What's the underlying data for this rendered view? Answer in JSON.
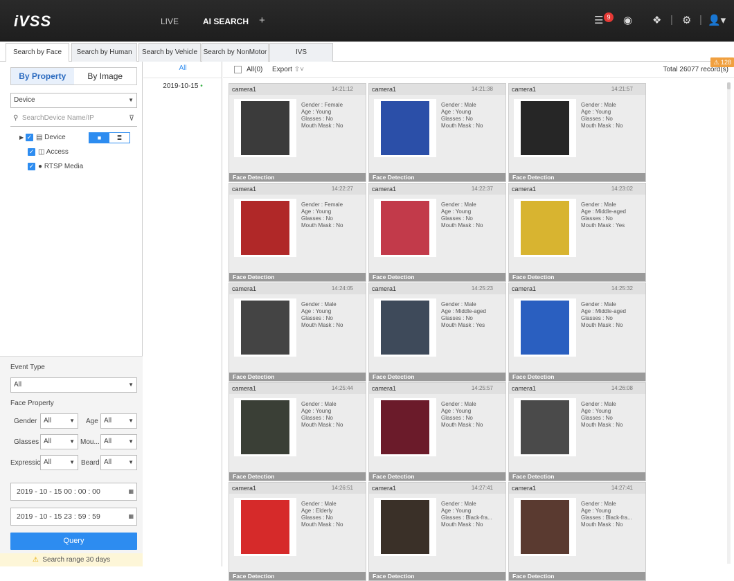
{
  "topbar": {
    "logo": "iVSS",
    "tabs": [
      "LIVE",
      "AI SEARCH"
    ],
    "add_tab": "+",
    "notif_count": "9"
  },
  "tabs": [
    "Search by Face",
    "Search by Human",
    "Search by Vehicle",
    "Search by NonMotor",
    "IVS"
  ],
  "sidebar": {
    "mode_tabs": [
      "By Property",
      "By Image"
    ],
    "device_select": "Device",
    "search_placeholder": "SearchDevice Name/IP",
    "tree": [
      "Device",
      "Access",
      "RTSP Media"
    ]
  },
  "filters": {
    "event_type_label": "Event Type",
    "event_type_value": "All",
    "face_property_label": "Face Property",
    "gender_label": "Gender",
    "gender_value": "All",
    "age_label": "Age",
    "age_value": "All",
    "glasses_label": "Glasses",
    "glasses_value": "All",
    "mouth_label": "Mou...",
    "mouth_value": "All",
    "expression_label": "Expressic",
    "expression_value": "All",
    "beard_label": "Beard",
    "beard_value": "All",
    "start_time": "2019 - 10 - 15  00 : 00 : 00",
    "end_time": "2019 - 10 - 15  23 : 59 : 59",
    "query": "Query",
    "range_warning": "Search range 30 days"
  },
  "datecol": {
    "all": "All",
    "date": "2019-10-15"
  },
  "main": {
    "all_label": "All(0)",
    "export": "Export",
    "total": "Total 26077 record(s)",
    "alarm_count": "128"
  },
  "footer_label": "Face Detection",
  "cards": [
    {
      "camera": "camera1",
      "time": "14:21:12",
      "gender": "Gender : Female",
      "age": "Age : Young",
      "glasses": "Glasses : No",
      "mask": "Mouth Mask : No",
      "color": "#3b3b3b"
    },
    {
      "camera": "camera1",
      "time": "14:21:38",
      "gender": "Gender : Male",
      "age": "Age : Young",
      "glasses": "Glasses : No",
      "mask": "Mouth Mask : No",
      "color": "#2b4fa8"
    },
    {
      "camera": "camera1",
      "time": "14:21:57",
      "gender": "Gender : Male",
      "age": "Age : Young",
      "glasses": "Glasses : No",
      "mask": "Mouth Mask : No",
      "color": "#262626"
    },
    {
      "camera": "camera1",
      "time": "14:22:27",
      "gender": "Gender : Female",
      "age": "Age : Young",
      "glasses": "Glasses : No",
      "mask": "Mouth Mask : No",
      "color": "#b02828"
    },
    {
      "camera": "camera1",
      "time": "14:22:37",
      "gender": "Gender : Male",
      "age": "Age : Young",
      "glasses": "Glasses : No",
      "mask": "Mouth Mask : No",
      "color": "#c23a4a"
    },
    {
      "camera": "camera1",
      "time": "14:23:02",
      "gender": "Gender : Male",
      "age": "Age : Middle-aged",
      "glasses": "Glasses : No",
      "mask": "Mouth Mask : Yes",
      "color": "#d8b430"
    },
    {
      "camera": "camera1",
      "time": "14:24:05",
      "gender": "Gender : Male",
      "age": "Age : Young",
      "glasses": "Glasses : No",
      "mask": "Mouth Mask : No",
      "color": "#444"
    },
    {
      "camera": "camera1",
      "time": "14:25:23",
      "gender": "Gender : Male",
      "age": "Age : Middle-aged",
      "glasses": "Glasses : No",
      "mask": "Mouth Mask : Yes",
      "color": "#3e4a5a"
    },
    {
      "camera": "camera1",
      "time": "14:25:32",
      "gender": "Gender : Male",
      "age": "Age : Middle-aged",
      "glasses": "Glasses : No",
      "mask": "Mouth Mask : No",
      "color": "#2a5fc0"
    },
    {
      "camera": "camera1",
      "time": "14:25:44",
      "gender": "Gender : Male",
      "age": "Age : Young",
      "glasses": "Glasses : No",
      "mask": "Mouth Mask : No",
      "color": "#3a3f36"
    },
    {
      "camera": "camera1",
      "time": "14:25:57",
      "gender": "Gender : Male",
      "age": "Age : Young",
      "glasses": "Glasses : No",
      "mask": "Mouth Mask : No",
      "color": "#6b1b2a"
    },
    {
      "camera": "camera1",
      "time": "14:26:08",
      "gender": "Gender : Male",
      "age": "Age : Young",
      "glasses": "Glasses : No",
      "mask": "Mouth Mask : No",
      "color": "#4a4a4a"
    },
    {
      "camera": "camera1",
      "time": "14:26:51",
      "gender": "Gender : Male",
      "age": "Age : Elderly",
      "glasses": "Glasses : No",
      "mask": "Mouth Mask : No",
      "color": "#d62a2a"
    },
    {
      "camera": "camera1",
      "time": "14:27:41",
      "gender": "Gender : Male",
      "age": "Age : Young",
      "glasses": "Glasses : Black-fra...",
      "mask": "Mouth Mask : No",
      "color": "#3a3028"
    },
    {
      "camera": "camera1",
      "time": "14:27:41",
      "gender": "Gender : Male",
      "age": "Age : Young",
      "glasses": "Glasses : Black-fra...",
      "mask": "Mouth Mask : No",
      "color": "#5a3a30"
    }
  ]
}
